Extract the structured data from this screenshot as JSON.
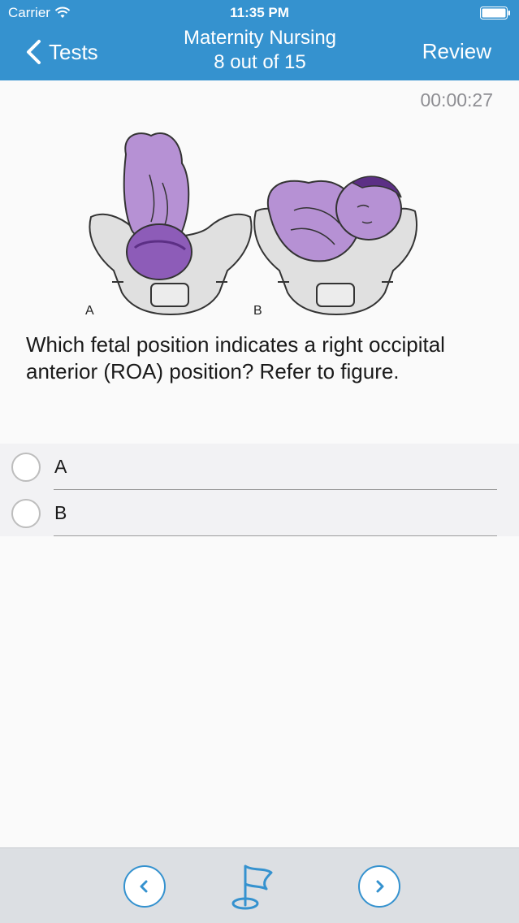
{
  "status_bar": {
    "carrier": "Carrier",
    "time": "11:35 PM"
  },
  "nav": {
    "back_label": "Tests",
    "title": "Maternity Nursing",
    "subtitle": "8 out of 15",
    "review_label": "Review"
  },
  "timer": "00:00:27",
  "figure": {
    "label_a": "A",
    "label_b": "B"
  },
  "question": "Which fetal position indicates a right occipital anterior (ROA) position? Refer to figure.",
  "answers": [
    {
      "label": "A"
    },
    {
      "label": "B"
    }
  ],
  "colors": {
    "accent": "#3592cf",
    "fetus": "#b691d4",
    "pelvis": "#e0e0e0"
  },
  "icons": {
    "back": "chevron-left-icon",
    "prev": "chevron-left-icon",
    "flag": "flag-icon",
    "next": "chevron-right-icon"
  }
}
